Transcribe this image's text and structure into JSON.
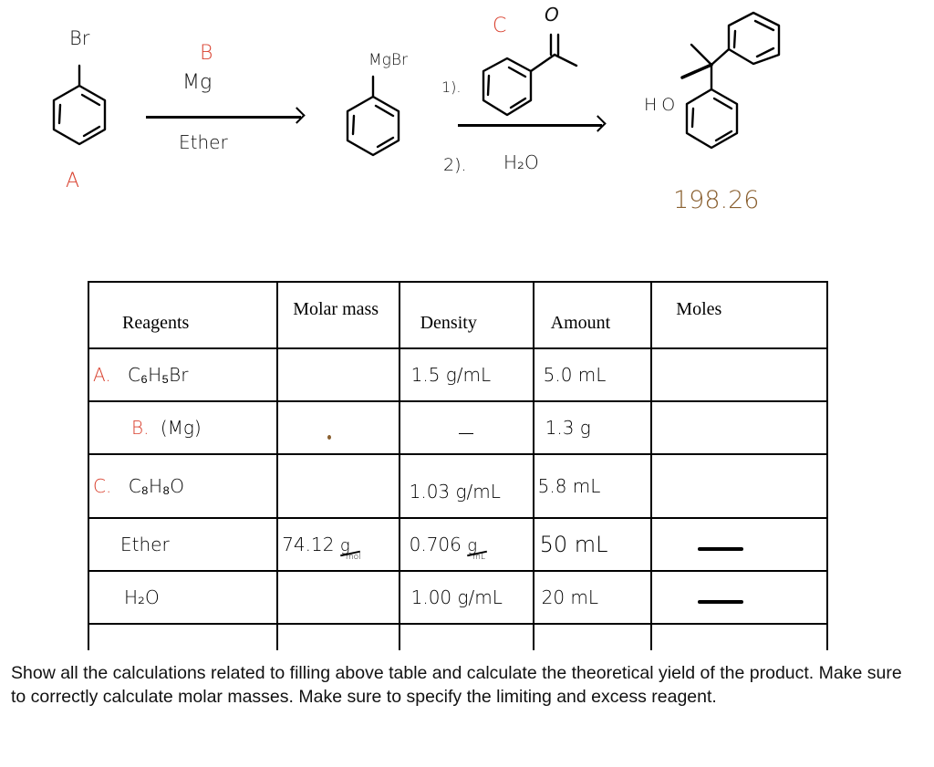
{
  "scheme": {
    "reactant_a": {
      "label": "A",
      "substituent": "Br",
      "name": "bromobenzene"
    },
    "step1": {
      "label": "B",
      "reagent": "Mg",
      "solvent": "Ether"
    },
    "intermediate": {
      "substituent": "MgBr",
      "name": "phenylmagnesium bromide"
    },
    "step2": {
      "label": "C",
      "carbonyl_atom": "O",
      "line1": "1).",
      "line2": "2).",
      "line2_reagent": "H₂O",
      "name": "acetophenone"
    },
    "product": {
      "group": "HO",
      "molar_mass": "198.26",
      "name": "1,1-diphenylethanol"
    }
  },
  "table": {
    "headers": [
      "Reagents",
      "Molar mass",
      "Density",
      "Amount",
      "Moles"
    ],
    "rows": [
      {
        "label_prefix": "A.",
        "reagent": "C₆H₅Br",
        "molar_mass": "",
        "density": "1.5 g/mL",
        "amount": "5.0 mL",
        "moles": ""
      },
      {
        "label_prefix": "B.",
        "reagent": "(Mg)",
        "molar_mass": "",
        "density": "—",
        "amount": "1.3 g",
        "moles": ""
      },
      {
        "label_prefix": "C.",
        "reagent": "C₈H₈O",
        "molar_mass": "",
        "density": "1.03 g/mL",
        "amount": "5.8 mL",
        "moles": ""
      },
      {
        "label_prefix": "",
        "reagent": "Ether",
        "molar_mass": "74.12",
        "molar_mass_unit_num": "g",
        "molar_mass_unit_den": "mol",
        "density": "0.706",
        "density_unit_num": "g",
        "density_unit_den": "mL",
        "amount": "50 mL",
        "moles": "—"
      },
      {
        "label_prefix": "",
        "reagent": "H₂O",
        "molar_mass": "",
        "density": "1.00 g/mL",
        "amount": "20 mL",
        "moles": "—"
      }
    ]
  },
  "question": "Show all the calculations related to filling above table and calculate the theoretical yield of the product. Make sure to correctly calculate molar masses. Make sure to specify the limiting and excess reagent.",
  "colors": {
    "label_red": "#d9412f",
    "annotation_brown": "#8a6030"
  }
}
